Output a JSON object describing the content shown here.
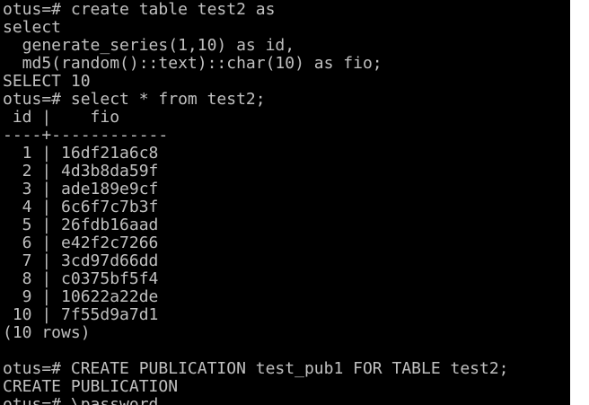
{
  "terminal": {
    "colors": {
      "background": "#000000",
      "foreground": "#c0c0c0"
    },
    "lines": [
      "otus=# create table test2 as",
      "select",
      "  generate_series(1,10) as id,",
      "  md5(random()::text)::char(10) as fio;",
      "SELECT 10",
      "otus=# select * from test2;",
      " id |    fio",
      "----+------------",
      "  1 | 16df21a6c8",
      "  2 | 4d3b8da59f",
      "  3 | ade189e9cf",
      "  4 | 6c6f7c7b3f",
      "  5 | 26fdb16aad",
      "  6 | e42f2c7266",
      "  7 | 3cd97d66dd",
      "  8 | c0375bf5f4",
      "  9 | 10622a22de",
      " 10 | 7f55d9a7d1",
      "(10 rows)",
      "",
      "otus=# CREATE PUBLICATION test_pub1 FOR TABLE test2;",
      "CREATE PUBLICATION",
      "otus=# \\password"
    ]
  }
}
